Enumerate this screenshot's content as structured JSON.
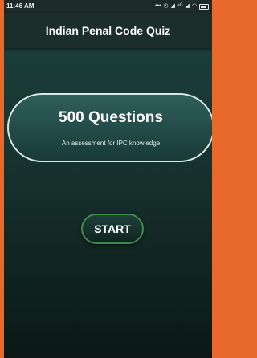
{
  "status_bar": {
    "time": "11:46 AM",
    "icons": [
      "more-dots-icon",
      "alarm-icon",
      "signal-icon",
      "4g-icon",
      "signal-2-icon",
      "wifi-icon",
      "battery-icon"
    ]
  },
  "header": {
    "title": "Indian Penal Code Quiz"
  },
  "quiz_card": {
    "title": "500 Questions",
    "subtitle": "An assessment for IPC knowledge"
  },
  "start_button": {
    "label": "START"
  },
  "colors": {
    "frame_accent": "#e8692a",
    "background_top": "#1d4340",
    "background_bottom": "#0b1816",
    "header_bg": "#1b2e2b",
    "card_border": "#d9e6e4",
    "start_border": "#3e8a4d"
  }
}
